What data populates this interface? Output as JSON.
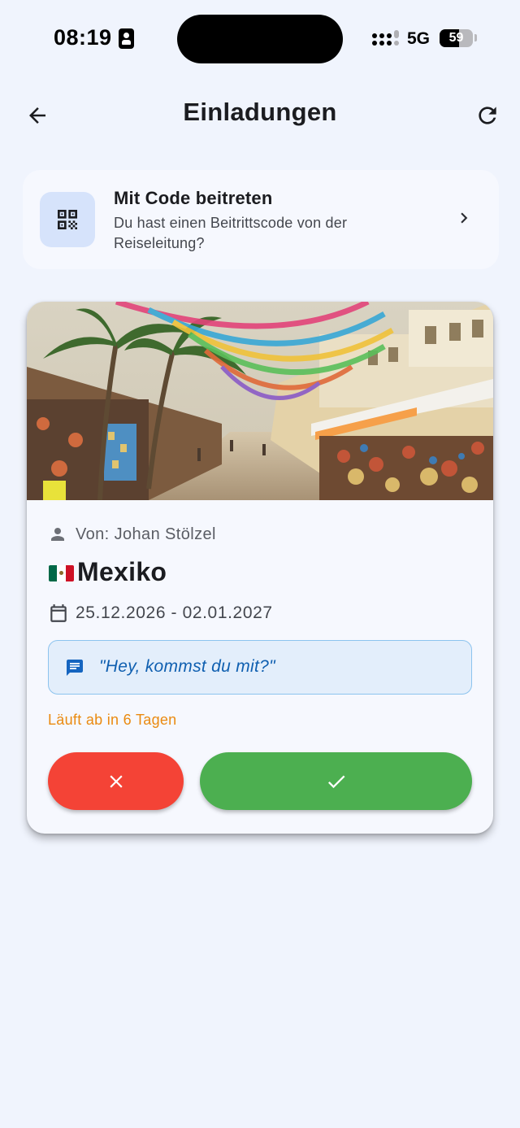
{
  "status_bar": {
    "time": "08:19",
    "network": "5G",
    "battery": "59",
    "battery_level": 0.59
  },
  "app_bar": {
    "title": "Einladungen",
    "back_icon": "arrow-left-icon",
    "refresh_icon": "refresh-icon"
  },
  "join_code": {
    "title": "Mit Code beitreten",
    "subtitle": "Du hast einen Beitrittscode von der Reiseleitung?",
    "icon": "qr-code-icon",
    "chevron_icon": "chevron-right-icon"
  },
  "invitation": {
    "from": "Von: Johan Stölzel",
    "flag_colors": [
      "#006847",
      "#ffffff",
      "#ce1126"
    ],
    "destination": "Mexiko",
    "dates": "25.12.2026 - 02.01.2027",
    "message": "\"Hey, kommst du mit?\"",
    "expires": "Läuft ab in 6 Tagen",
    "decline_icon": "close-icon",
    "accept_icon": "check-icon"
  },
  "colors": {
    "background": "#f0f4fd",
    "decline": "#f44336",
    "accept": "#4caf50",
    "expires": "#ea8a10",
    "message_text": "#0f5fb0"
  }
}
